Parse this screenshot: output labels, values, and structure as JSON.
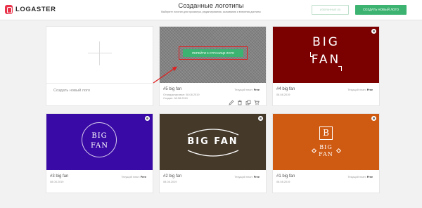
{
  "header": {
    "brand": "LOGASTER",
    "title": "Созданные логотипы",
    "subtitle": "Выберите логотип для просмотра, редактирования, скачивания и внесения доплаты",
    "btn_secondary": "ИЗБРАННЫЕ (0)",
    "btn_primary": "СОЗДАТЬ НОВЫЙ ЛОГО"
  },
  "create_card": {
    "label": "Создать новый лого"
  },
  "cards": [
    {
      "name": "#5 big fan",
      "plan_label": "Текущий план:",
      "plan_value": "Free",
      "modified": "Отредактирован: 08.08.2019",
      "created": "Создан: 08.08.2019",
      "hover_button": "ПЕРЕЙТИ К СТРАНИЦЕ ЛОГО"
    },
    {
      "name": "#4 big fan",
      "plan_label": "Текущий план:",
      "plan_value": "Free",
      "date": "08.08.2019",
      "logo_line1": "BIG",
      "logo_line2": "FAN"
    },
    {
      "name": "#3 big fan",
      "plan_label": "Текущий план:",
      "plan_value": "Free",
      "date": "08.08.2019",
      "logo_line1": "BIG",
      "logo_line2": "FAN"
    },
    {
      "name": "#2 big fan",
      "plan_label": "Текущий план:",
      "plan_value": "Free",
      "date": "08.08.2019",
      "logo_text": "BIG FAN"
    },
    {
      "name": "#1 big fan",
      "plan_label": "Текущий план:",
      "plan_value": "Free",
      "date": "08.08.2019",
      "logo_letter": "B",
      "logo_line1": "BIG",
      "logo_line2": "FAN"
    }
  ],
  "colors": {
    "accent_green": "#3cb371",
    "brand_red": "#e8334a",
    "card4_bg": "#7b0000",
    "card3_bg": "#3a0aa6",
    "card2_bg": "#45392a",
    "card1_bg": "#cf5a12",
    "annotation_red": "#e02020"
  },
  "icons": [
    "pencil-icon",
    "trash-icon",
    "copy-icon",
    "cart-icon",
    "lock-icon"
  ]
}
